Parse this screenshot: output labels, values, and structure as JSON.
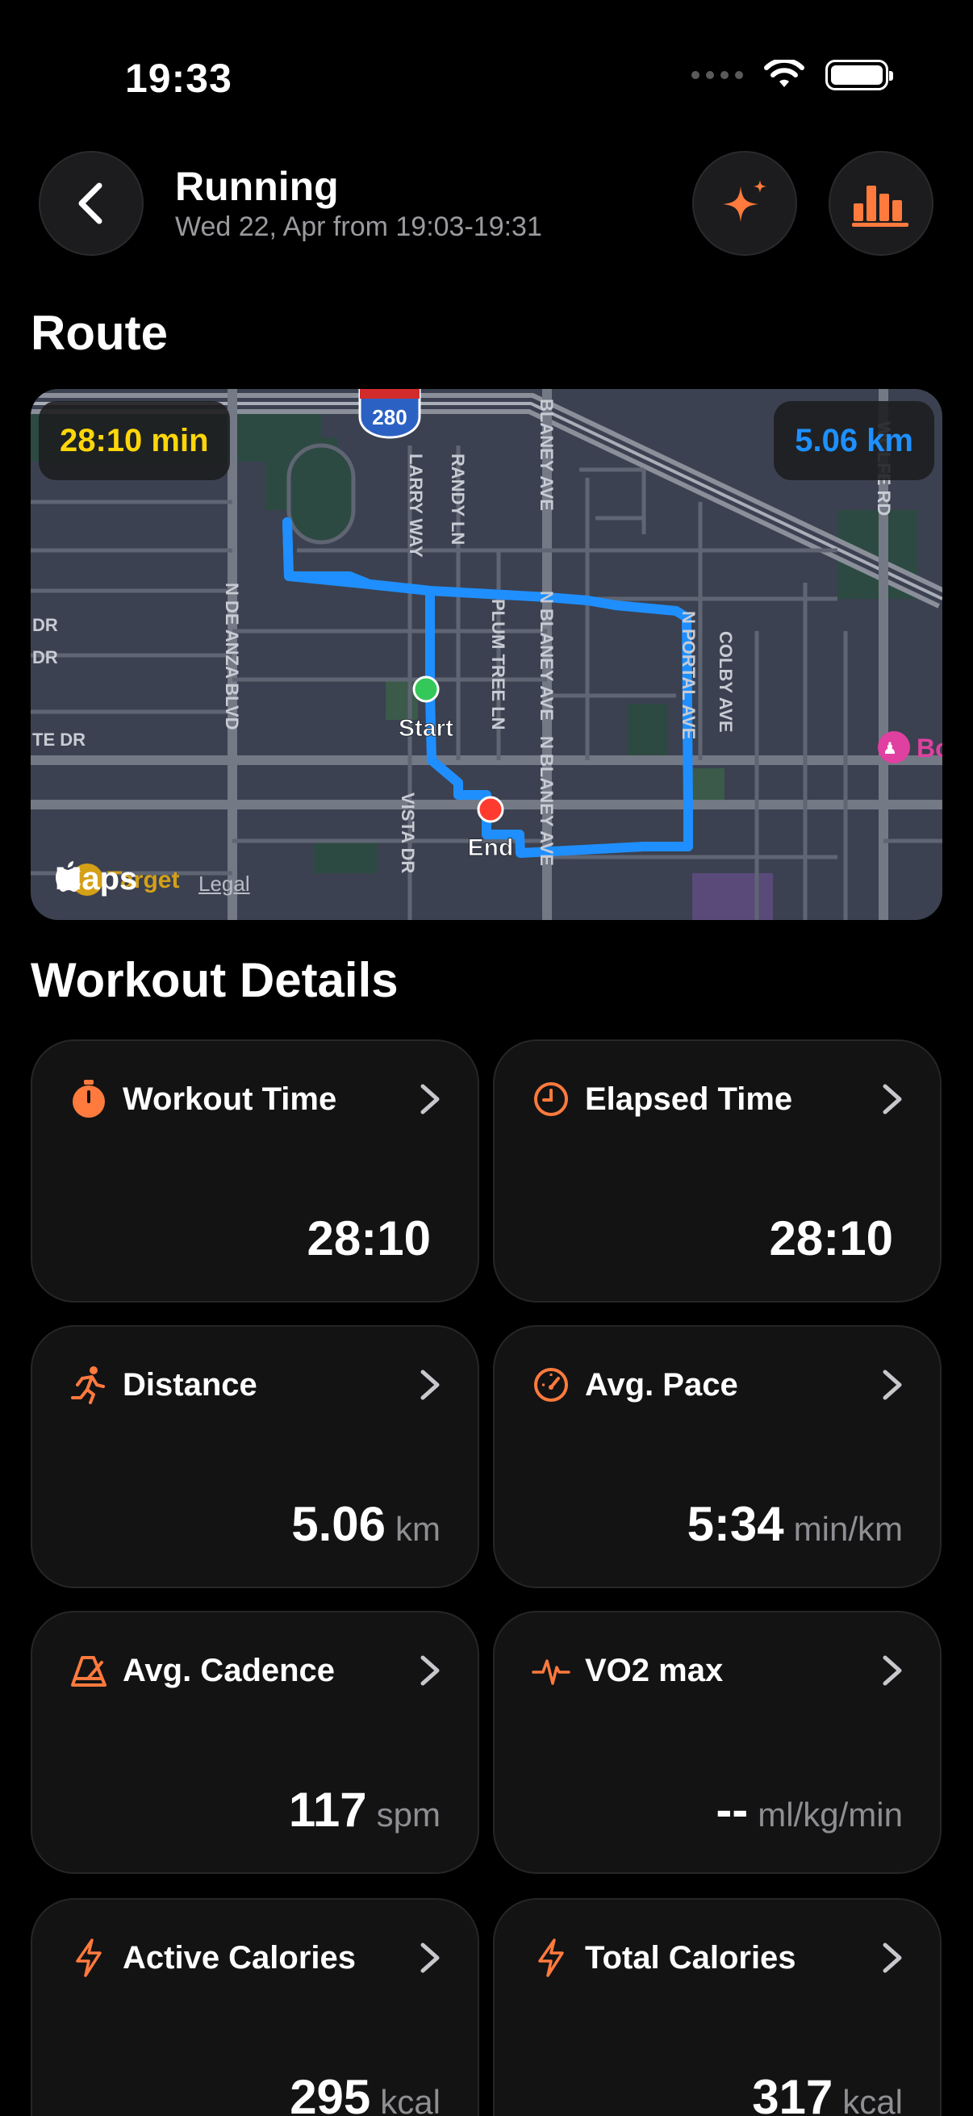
{
  "status_bar": {
    "time": "19:33"
  },
  "header": {
    "title": "Running",
    "subtitle": "Wed 22, Apr from 19:03-19:31"
  },
  "route": {
    "section_title": "Route",
    "time_badge": "28:10 min",
    "distance_badge": "5.06 km",
    "start_label": "Start",
    "end_label": "End",
    "maps_label": "Maps",
    "legal_label": "Legal",
    "highway_shield": "280",
    "street_labels": {
      "de_anza": "N DE ANZA BLVD",
      "larry": "LARRY WAY",
      "randy": "RANDY LN",
      "blaney_top": "BLANEY AVE",
      "plum_tree": "PLUM TREE LN",
      "n_blaney_1": "N BLANEY AVE",
      "n_blaney_2": "N BLANEY AVE",
      "portal": "N PORTAL AVE",
      "colby": "COLBY AVE",
      "wolfe": "WOLFE RD",
      "vista": "VISTA DR",
      "dr_1": "DR",
      "dr_2": "DR",
      "te_dr": "TE DR"
    },
    "poi_label": "Bo",
    "target_label": "Target",
    "colors": {
      "route": "#1f8fff",
      "start": "#34c759",
      "end": "#ff3b30"
    }
  },
  "workout_details": {
    "section_title": "Workout Details",
    "cards": [
      {
        "label": "Workout Time",
        "value": "28:10",
        "unit": "",
        "icon": "stopwatch-icon"
      },
      {
        "label": "Elapsed Time",
        "value": "28:10",
        "unit": "",
        "icon": "clock-icon"
      },
      {
        "label": "Distance",
        "value": "5.06",
        "unit": "km",
        "icon": "runner-icon"
      },
      {
        "label": "Avg. Pace",
        "value": "5:34",
        "unit": "min/km",
        "icon": "speedometer-icon"
      },
      {
        "label": "Avg. Cadence",
        "value": "117",
        "unit": "spm",
        "icon": "metronome-icon"
      },
      {
        "label": "VO2 max",
        "value": "--",
        "unit": "ml/kg/min",
        "icon": "heartbeat-icon"
      },
      {
        "label": "Active Calories",
        "value": "295",
        "unit": "kcal",
        "icon": "bolt-icon"
      },
      {
        "label": "Total Calories",
        "value": "317",
        "unit": "kcal",
        "icon": "bolt-icon"
      }
    ]
  },
  "colors": {
    "accent": "#ff7a3d",
    "card_bg": "#131314",
    "secondary_text": "#9a9a9f"
  }
}
